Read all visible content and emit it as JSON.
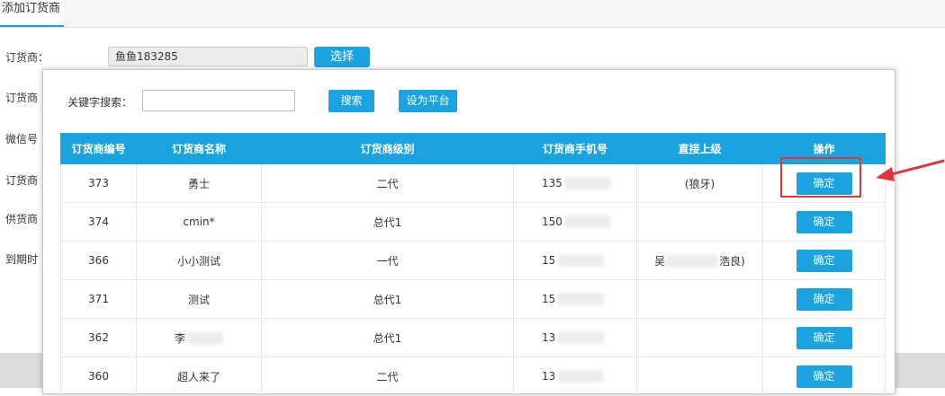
{
  "tab": {
    "label": "添加订货商"
  },
  "form": {
    "labels": [
      "订货商：",
      "订货商",
      "微信号",
      "订货商",
      "供货商",
      "到期时"
    ],
    "supplier_value": "鱼鱼183285",
    "select_label": "选择"
  },
  "modal": {
    "keyword_label": "关键字搜索：",
    "keyword_value": "",
    "search_label": "搜索",
    "platform_label": "设为平台",
    "columns": [
      "订货商编号",
      "订货商名称",
      "订货商级别",
      "订货商手机号",
      "直接上级",
      "操作"
    ],
    "rows": [
      {
        "id": "373",
        "name": "勇士",
        "level": "二代",
        "phone": "135",
        "parent": "(狼牙)",
        "action": "确定"
      },
      {
        "id": "374",
        "name": "cmin*",
        "level": "总代1",
        "phone": "150",
        "parent": "",
        "action": "确定"
      },
      {
        "id": "366",
        "name": "小小测试",
        "level": "一代",
        "phone": "15",
        "parent_prefix": "吴",
        "parent_suffix": "浩良)",
        "action": "确定"
      },
      {
        "id": "371",
        "name": "测试",
        "level": "总代1",
        "phone": "15",
        "parent": "",
        "action": "确定"
      },
      {
        "id": "362",
        "name": "李",
        "level": "总代1",
        "phone": "13",
        "parent": "",
        "action": "确定"
      },
      {
        "id": "360",
        "name": "超人来了",
        "level": "二代",
        "phone": "13",
        "parent": "",
        "action": "确定"
      }
    ]
  },
  "colors": {
    "accent": "#1aa3e0",
    "highlight": "#e03636"
  },
  "icons": {
    "annotation_arrow": "red-arrow-icon"
  }
}
